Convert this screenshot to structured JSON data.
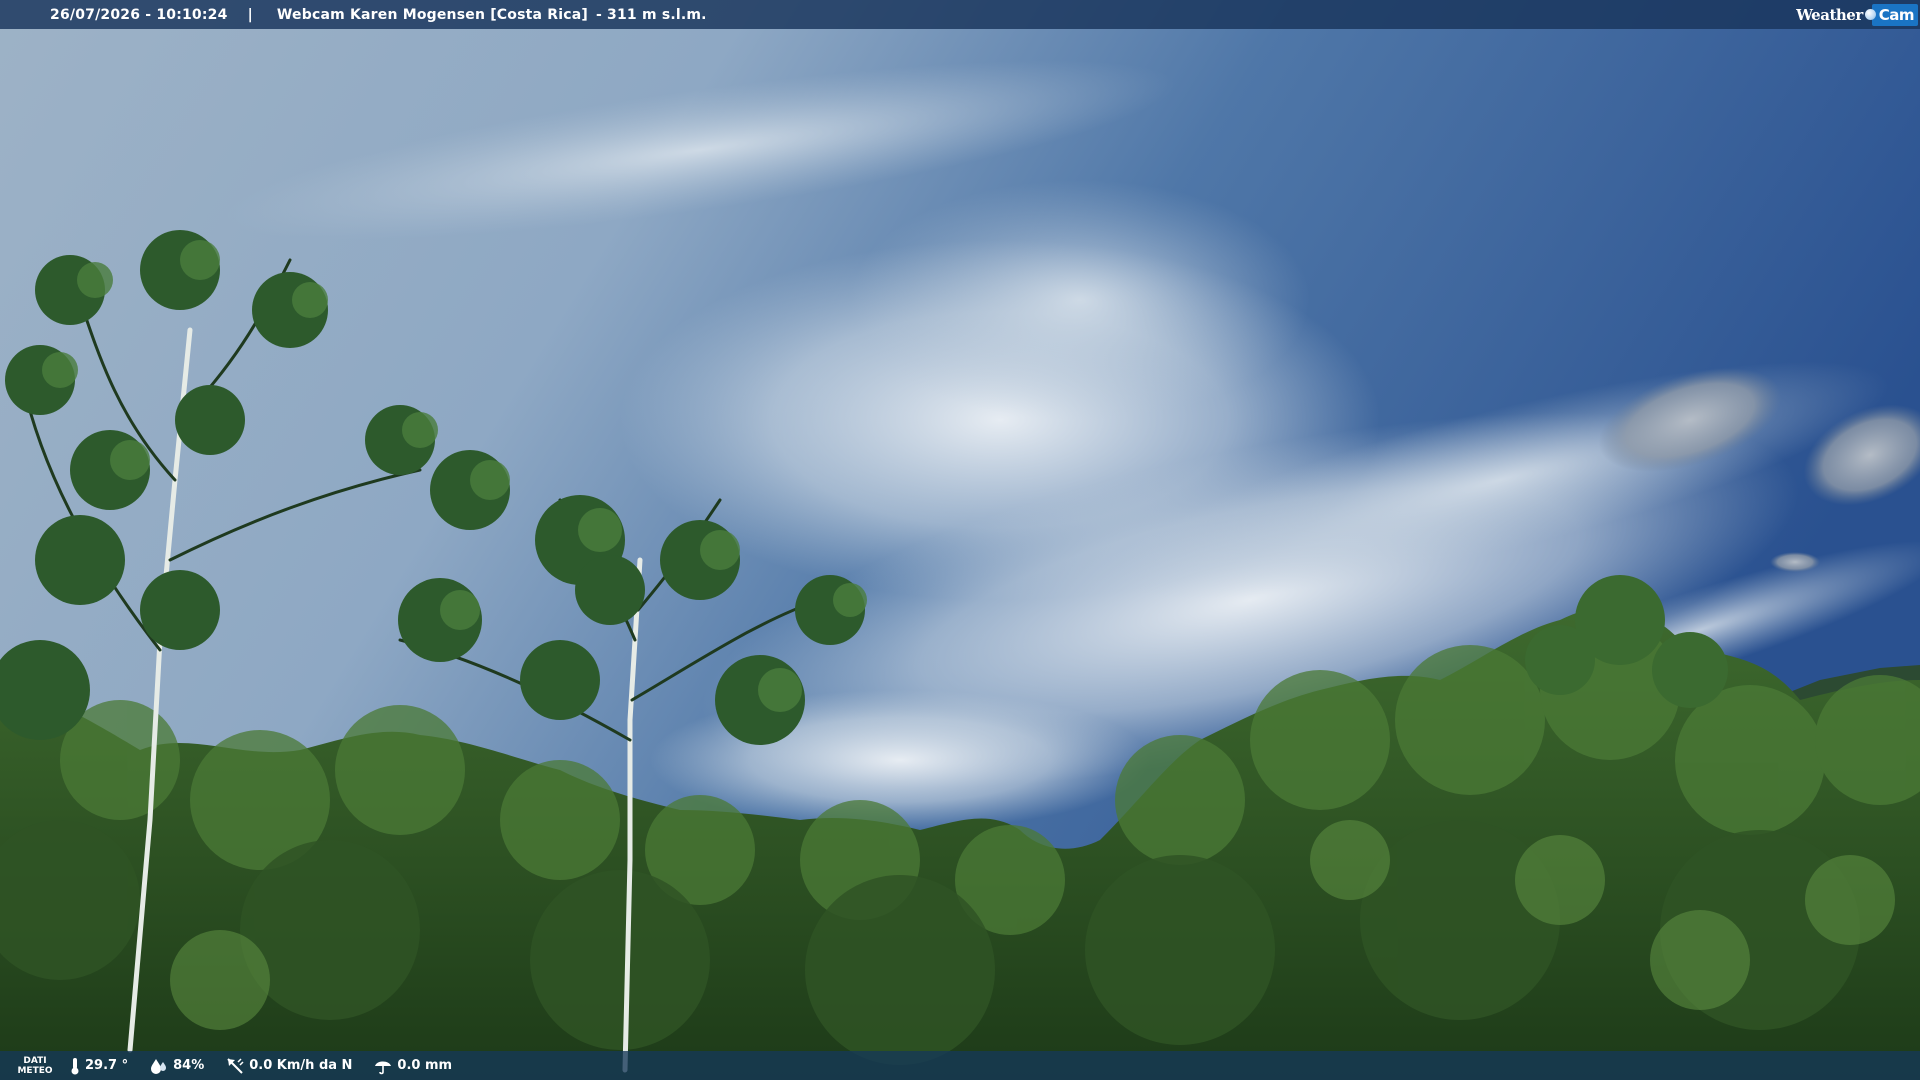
{
  "header": {
    "datetime": "26/07/2026 - 10:10:24",
    "separator": "|",
    "title": "Webcam Karen Mogensen [Costa Rica]",
    "altitude": "- 311 m s.l.m."
  },
  "logo": {
    "word1": "Weather",
    "word2": "Cam",
    "accent_color": "#1a74c4"
  },
  "footer": {
    "label_line1": "DATI",
    "label_line2": "METEO",
    "temperature": "29.7 °",
    "humidity": "84%",
    "wind": "0.0 Km/h da N",
    "rain": "0.0 mm",
    "icons": {
      "temperature": "thermometer-icon",
      "humidity": "droplet-icon",
      "wind": "wind-vane-icon",
      "rain": "umbrella-icon"
    }
  },
  "colors": {
    "bar_background": "#18345c",
    "text": "#ffffff"
  }
}
